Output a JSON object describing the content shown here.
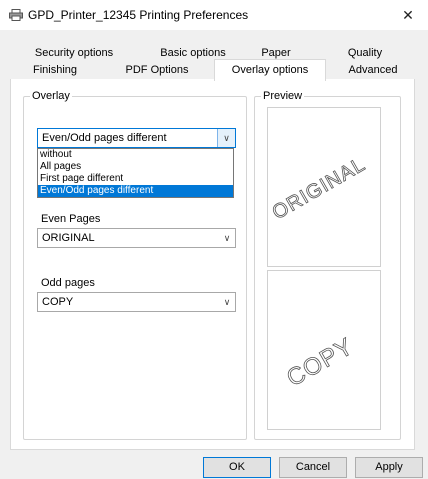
{
  "window": {
    "title": "GPD_Printer_12345 Printing Preferences",
    "close_symbol": "✕"
  },
  "tabs": {
    "row1": [
      "Security options",
      "Basic options",
      "Paper",
      "Quality"
    ],
    "row2": [
      "Finishing",
      "PDF Options",
      "Overlay options",
      "Advanced"
    ],
    "active": "Overlay options"
  },
  "overlay": {
    "group_label": "Overlay",
    "mode_selected": "Even/Odd pages different",
    "mode_options": [
      "without",
      "All pages",
      "First page different",
      "Even/Odd pages different"
    ],
    "even_label": "Even Pages",
    "even_value": "ORIGINAL",
    "odd_label": "Odd pages",
    "odd_value": "COPY"
  },
  "preview": {
    "group_label": "Preview",
    "page1_watermark": "ORIGINAL",
    "page2_watermark": "COPY"
  },
  "buttons": {
    "ok": "OK",
    "cancel": "Cancel",
    "apply": "Apply"
  },
  "colors": {
    "accent": "#0078d7",
    "watermark_stroke": "#555555"
  }
}
